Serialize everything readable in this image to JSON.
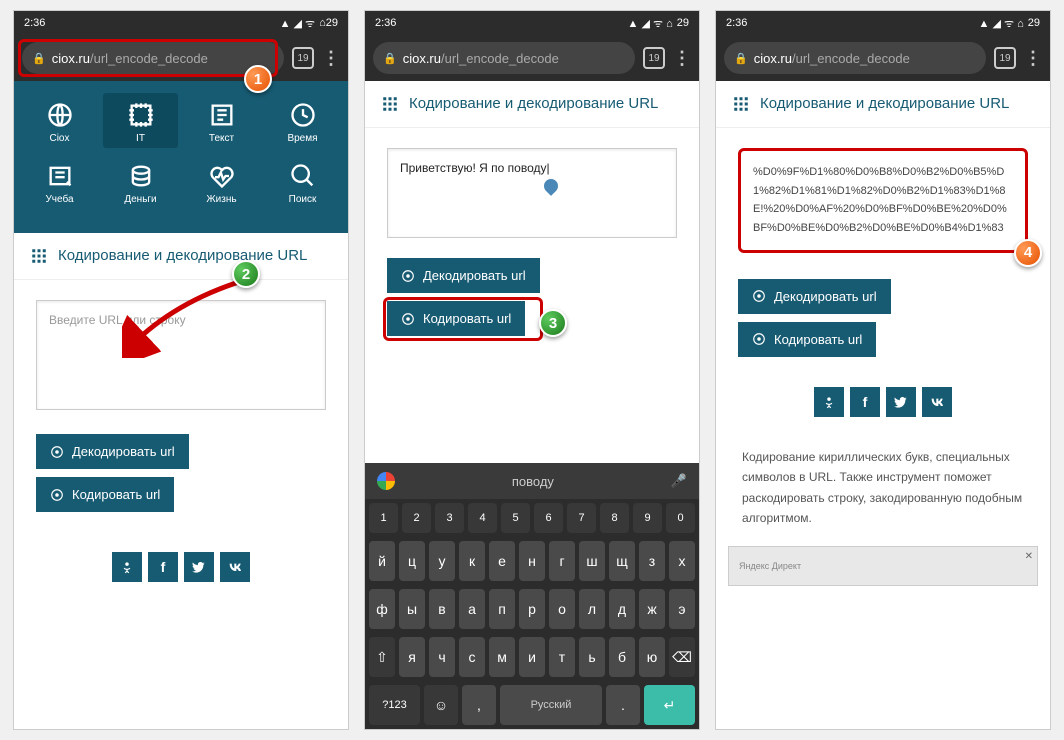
{
  "status": {
    "time": "2:36",
    "battery": "29"
  },
  "browser": {
    "lock": "🔒",
    "domain": "ciox.ru",
    "path": "/url_encode_decode",
    "tabs": "19",
    "menu": "⋮"
  },
  "nav": {
    "row1": [
      {
        "label": "Ciox"
      },
      {
        "label": "IT"
      },
      {
        "label": "Текст"
      },
      {
        "label": "Время"
      }
    ],
    "row2": [
      {
        "label": "Учеба"
      },
      {
        "label": "Деньги"
      },
      {
        "label": "Жизнь"
      },
      {
        "label": "Поиск"
      }
    ]
  },
  "page": {
    "title": "Кодирование и декодирование URL",
    "placeholder": "Введите URL или строку",
    "input_value": "Приветствую! Я по поводу",
    "encoded_value": "%D0%9F%D1%80%D0%B8%D0%B2%D0%B5%D1%82%D1%81%D1%82%D0%B2%D1%83%D1%8E!%20%D0%AF%20%D0%BF%D0%BE%20%D0%BF%D0%BE%D0%B2%D0%BE%D0%B4%D1%83",
    "btn_decode": "Декодировать url",
    "btn_encode": "Кодировать url",
    "description": "Кодирование кириллических букв, специальных символов в URL. Также инструмент поможет раскодировать строку, закодированную подобным алгоритмом.",
    "ad_label": "Яндекс Директ"
  },
  "social": [
    "ok",
    "f",
    "tw",
    "vk"
  ],
  "keyboard": {
    "suggest": "поводу",
    "numbers": [
      "1",
      "2",
      "3",
      "4",
      "5",
      "6",
      "7",
      "8",
      "9",
      "0"
    ],
    "r1": [
      "й",
      "ц",
      "у",
      "к",
      "е",
      "н",
      "г",
      "ш",
      "щ",
      "з",
      "х"
    ],
    "r2": [
      "ф",
      "ы",
      "в",
      "а",
      "п",
      "р",
      "о",
      "л",
      "д",
      "ж",
      "э"
    ],
    "r3": [
      "я",
      "ч",
      "с",
      "м",
      "и",
      "т",
      "ь",
      "б",
      "ю"
    ],
    "shift": "⇧",
    "bksp": "⌫",
    "sym": "?123",
    "lang": "Русский",
    "enter": "↵",
    "emoji": "☺",
    "comma": ",",
    "dot": "."
  },
  "callouts": {
    "1": "1",
    "2": "2",
    "3": "3",
    "4": "4"
  }
}
